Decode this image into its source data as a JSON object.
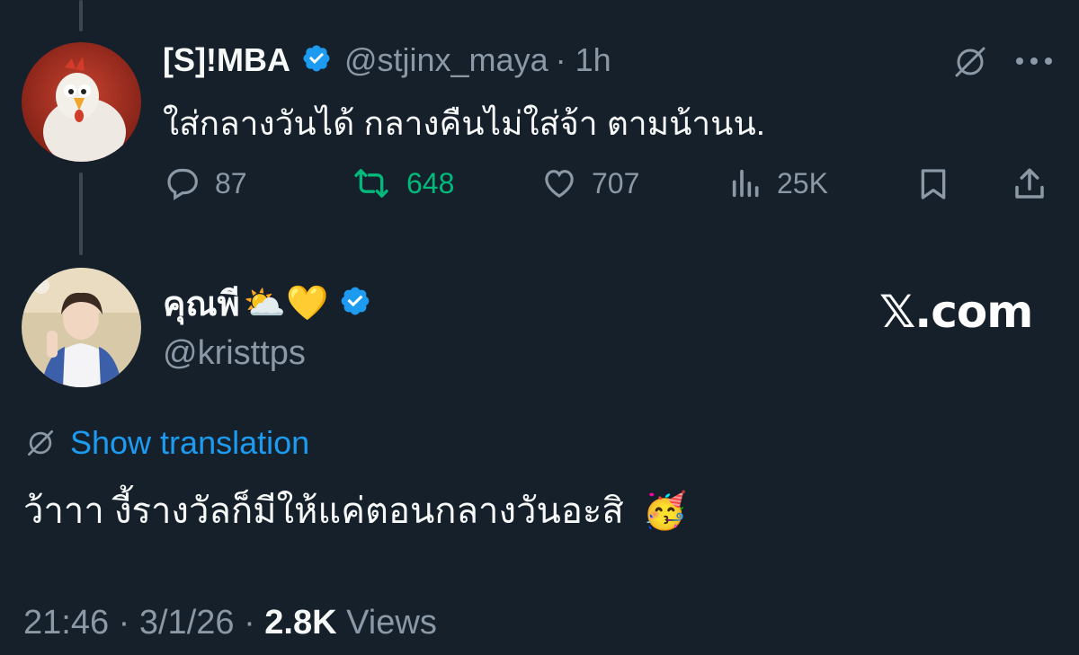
{
  "parent_tweet": {
    "display_name": "[S]!MBA",
    "handle": "@stjinx_maya",
    "time": "· 1h",
    "text": "ใส่กลางวันได้ กลางคืนไม่ใส่จ้า ตามน้านน.",
    "actions": {
      "replies": "87",
      "reposts": "648",
      "likes": "707",
      "views": "25K"
    },
    "icons": [
      "grok-icon",
      "more-icon",
      "reply-icon",
      "repost-icon",
      "like-icon",
      "views-icon",
      "bookmark-icon",
      "share-icon"
    ]
  },
  "main_tweet": {
    "display_name": "คุณพี",
    "name_emojis": "⛅💛",
    "handle": "@kristtps",
    "show_translation": "Show translation",
    "text": "ว้าาา งี้รางวัลก็มีให้แค่ตอนกลางวันอะสิ",
    "text_emoji": "🥳",
    "timestamp": "21:46 · 3/1/26 · ",
    "views_count": "2.8K",
    "views_label": " Views"
  },
  "watermark": "𝕏.com",
  "colors": {
    "background": "#15202b",
    "verified": "#1d9bf0",
    "link": "#1d9bf0",
    "repost_active": "#00ba7c",
    "muted": "#8b98a5"
  }
}
